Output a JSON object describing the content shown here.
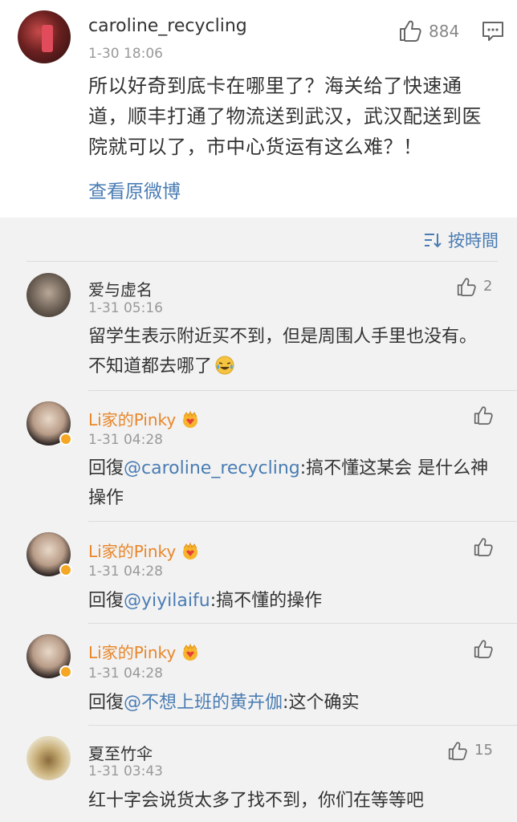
{
  "main_post": {
    "username": "caroline_recycling",
    "time": "1-30 18:06",
    "like_count": "884",
    "text": "所以好奇到底卡在哪里了？海关给了快速通道，顺丰打通了物流送到武汉，武汉配送到医院就可以了，市中心货运有这么难？！",
    "view_original": "查看原微博"
  },
  "sort": {
    "label": "按時間"
  },
  "comments": [
    {
      "username": "爱与虚名",
      "time": "1-31 05:16",
      "like_count": "2",
      "text": "留学生表示附近买不到，但是周围人手里也没有。不知道都去哪了",
      "emoji": "crying-laughing-emoji"
    },
    {
      "username": "Li家的Pinky",
      "time": "1-31 04:28",
      "reply_prefix": "回復",
      "mention": "@caroline_recycling",
      "text": ":搞不懂这某会  是什么神操作"
    },
    {
      "username": "Li家的Pinky",
      "time": "1-31 04:28",
      "reply_prefix": "回復",
      "mention": "@yiyilaifu",
      "text": ":搞不懂的操作"
    },
    {
      "username": "Li家的Pinky",
      "time": "1-31 04:28",
      "reply_prefix": "回復",
      "mention": "@不想上班的黄卉伽",
      "text": ":这个确实"
    },
    {
      "username": "夏至竹伞",
      "time": "1-31 03:43",
      "like_count": "15",
      "text": "红十字会说货太多了找不到，你们在等等吧"
    }
  ],
  "colors": {
    "link": "#4a7cb3",
    "vip_name": "#e8862a",
    "muted": "#999999"
  }
}
